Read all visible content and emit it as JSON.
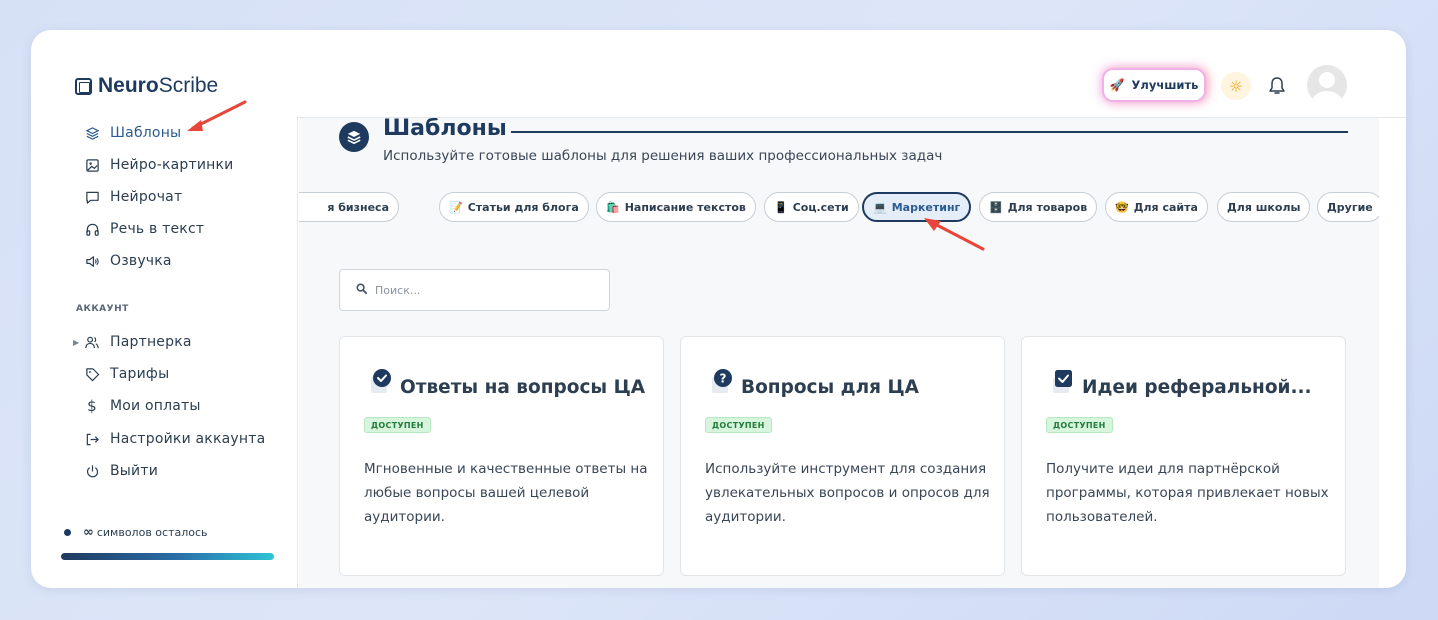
{
  "app": {
    "logo_bold": "Neuro",
    "logo_light": "Scribe"
  },
  "header": {
    "upgrade_label": "Улучшить"
  },
  "sidebar": {
    "items": [
      {
        "label": "Шаблоны",
        "icon": "layers-icon",
        "active": true
      },
      {
        "label": "Нейро-картинки",
        "icon": "image-icon"
      },
      {
        "label": "Нейрочат",
        "icon": "chat-icon"
      },
      {
        "label": "Речь в текст",
        "icon": "headphones-icon"
      },
      {
        "label": "Озвучка",
        "icon": "speaker-icon"
      }
    ],
    "account_label": "АККАУНТ",
    "account_items": [
      {
        "label": "Партнерка",
        "icon": "users-icon"
      },
      {
        "label": "Тарифы",
        "icon": "tag-icon"
      },
      {
        "label": "Мои оплаты",
        "icon": "dollar-icon"
      },
      {
        "label": "Настройки аккаунта",
        "icon": "login-icon"
      },
      {
        "label": "Выйти",
        "icon": "power-icon"
      }
    ],
    "chars_infinity": "∞",
    "chars_label": "символов осталось"
  },
  "main": {
    "title": "Шаблоны",
    "subtitle": "Используйте готовые шаблоны для решения ваших профессиональных задач",
    "chips": [
      {
        "label": "я бизнеса",
        "emoji": ""
      },
      {
        "label": "Статьи для блога",
        "emoji": "📝"
      },
      {
        "label": "Написание текстов",
        "emoji": "🛍️"
      },
      {
        "label": "Соц.сети",
        "emoji": "📱"
      },
      {
        "label": "Маркетинг",
        "emoji": "💻",
        "active": true
      },
      {
        "label": "Для товаров",
        "emoji": "🗄️"
      },
      {
        "label": "Для сайта",
        "emoji": "🤓"
      },
      {
        "label": "Для школы",
        "emoji": ""
      },
      {
        "label": "Другие",
        "emoji": ""
      }
    ],
    "search_placeholder": "Поиск...",
    "cards": [
      {
        "title": "Ответы на вопросы ЦА",
        "badge": "ДОСТУПЕН",
        "description": "Мгновенные и качественные ответы на любые вопросы вашей целевой аудитории.",
        "icon": "check-circle-icon"
      },
      {
        "title": "Вопросы для ЦА",
        "badge": "ДОСТУПЕН",
        "description": "Используйте инструмент для создания увлекательных вопросов и опросов для аудитории.",
        "icon": "question-circle-icon"
      },
      {
        "title": "Идеи реферальной...",
        "badge": "ДОСТУПЕН",
        "description": "Получите идеи для партнёрской программы, которая привлекает новых пользователей.",
        "icon": "checkbox-icon"
      }
    ]
  },
  "colors": {
    "brand": "#1e3a5f",
    "accent": "#2b5b91",
    "badge_bg": "#d7f5dd",
    "annotation_arrow": "#e8463a"
  }
}
